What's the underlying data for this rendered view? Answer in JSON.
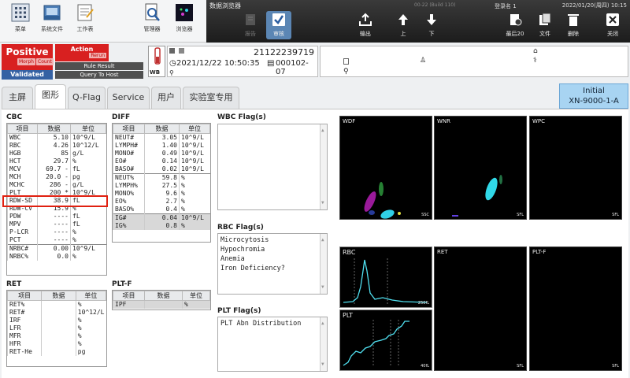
{
  "toolbar_left": [
    {
      "label": "菜单",
      "icon": "menu-grid-icon"
    },
    {
      "label": "系统文件",
      "icon": "system-folder-icon"
    },
    {
      "label": "工作表",
      "icon": "worksheet-icon"
    },
    {
      "label": "管理器",
      "icon": "manager-icon"
    },
    {
      "label": "浏览器",
      "icon": "explorer-icon"
    }
  ],
  "dark_toolbar": {
    "title": "数据浏览器",
    "build": "00-22 (Build 110)",
    "login": "登录名 1",
    "datetime": "2022/01/20(周四) 10:15",
    "buttons": [
      {
        "label": "报告",
        "icon": "report-icon",
        "state": "disabled"
      },
      {
        "label": "审核",
        "icon": "validate-check-icon",
        "state": "selected"
      },
      {
        "label": "输出",
        "icon": "export-icon",
        "state": "normal"
      },
      {
        "label": "上",
        "icon": "arrow-up-icon",
        "state": "normal"
      },
      {
        "label": "下",
        "icon": "arrow-down-icon",
        "state": "normal"
      },
      {
        "label": "最后20",
        "icon": "last20-icon",
        "state": "normal"
      },
      {
        "label": "文件",
        "icon": "file-icon",
        "state": "normal"
      },
      {
        "label": "删除",
        "icon": "trash-icon",
        "state": "normal"
      },
      {
        "label": "关闭",
        "icon": "close-icon",
        "state": "normal"
      }
    ]
  },
  "status": {
    "positive": "Positive",
    "morph": "Morph",
    "count": "Count",
    "validated": "Validated",
    "action": "Action",
    "rerun": "Rerun",
    "rule_result": "Rule Result",
    "query_host": "Query To Host",
    "wb": "WB"
  },
  "sample": {
    "id": "21122239719",
    "datetime": "2021/12/22 10:50:35",
    "seq": "000102-07"
  },
  "tabs": [
    {
      "label": "主屏"
    },
    {
      "label": "图形"
    },
    {
      "label": "Q-Flag"
    },
    {
      "label": "Service"
    },
    {
      "label": "用户"
    },
    {
      "label": "实验室专用"
    }
  ],
  "instrument": {
    "line1": "Initial",
    "line2": "XN-9000-1-A"
  },
  "headers": {
    "item": "项目",
    "data": "数据",
    "unit": "单位"
  },
  "cbc": {
    "title": "CBC",
    "rows": [
      {
        "n": "WBC",
        "v": "5.10",
        "f": "",
        "u": "10^9/L"
      },
      {
        "n": "RBC",
        "v": "4.26",
        "f": "",
        "u": "10^12/L"
      },
      {
        "n": "HGB",
        "v": "85",
        "f": "",
        "u": "g/L"
      },
      {
        "n": "HCT",
        "v": "29.7",
        "f": "",
        "u": "%"
      },
      {
        "n": "MCV",
        "v": "69.7",
        "f": "-",
        "u": "fL"
      },
      {
        "n": "MCH",
        "v": "20.0",
        "f": "-",
        "u": "pg"
      },
      {
        "n": "MCHC",
        "v": "286",
        "f": "-",
        "u": "g/L"
      },
      {
        "n": "PLT",
        "v": "200",
        "f": "*",
        "u": "10^9/L"
      },
      {
        "n": "RDW-SD",
        "v": "38.9",
        "f": "",
        "u": "fL"
      },
      {
        "n": "RDW-CV",
        "v": "15.9",
        "f": "",
        "u": "%"
      },
      {
        "n": "PDW",
        "v": "----",
        "f": "",
        "u": "fL"
      },
      {
        "n": "MPV",
        "v": "----",
        "f": "",
        "u": "fL"
      },
      {
        "n": "P-LCR",
        "v": "----",
        "f": "",
        "u": "%"
      },
      {
        "n": "PCT",
        "v": "----",
        "f": "",
        "u": "%"
      },
      {
        "n": "NRBC#",
        "v": "0.00",
        "f": "",
        "u": "10^9/L"
      },
      {
        "n": "NRBC%",
        "v": "0.0",
        "f": "",
        "u": "%"
      }
    ]
  },
  "diff": {
    "title": "DIFF",
    "rows": [
      {
        "n": "NEUT#",
        "v": "3.05",
        "u": "10^9/L"
      },
      {
        "n": "LYMPH#",
        "v": "1.40",
        "u": "10^9/L"
      },
      {
        "n": "MONO#",
        "v": "0.49",
        "u": "10^9/L"
      },
      {
        "n": "EO#",
        "v": "0.14",
        "u": "10^9/L"
      },
      {
        "n": "BASO#",
        "v": "0.02",
        "u": "10^9/L"
      },
      {
        "n": "NEUT%",
        "v": "59.8",
        "u": "%"
      },
      {
        "n": "LYMPH%",
        "v": "27.5",
        "u": "%"
      },
      {
        "n": "MONO%",
        "v": "9.6",
        "u": "%"
      },
      {
        "n": "EO%",
        "v": "2.7",
        "u": "%"
      },
      {
        "n": "BASO%",
        "v": "0.4",
        "u": "%"
      },
      {
        "n": "IG#",
        "v": "0.04",
        "u": "10^9/L"
      },
      {
        "n": "IG%",
        "v": "0.8",
        "u": "%"
      }
    ]
  },
  "ret": {
    "title": "RET",
    "rows": [
      {
        "n": "RET%",
        "u": "%"
      },
      {
        "n": "RET#",
        "u": "10^12/L"
      },
      {
        "n": "IRF",
        "u": "%"
      },
      {
        "n": "LFR",
        "u": "%"
      },
      {
        "n": "MFR",
        "u": "%"
      },
      {
        "n": "HFR",
        "u": "%"
      },
      {
        "n": "RET-He",
        "u": "pg"
      }
    ]
  },
  "pltf": {
    "title": "PLT-F",
    "rows": [
      {
        "n": "IPF",
        "u": "%"
      }
    ]
  },
  "flags": {
    "wbc_title": "WBC Flag(s)",
    "rbc_title": "RBC Flag(s)",
    "rbc": [
      "Microcytosis",
      "Hypochromia",
      "Anemia",
      "Iron Deficiency?"
    ],
    "plt_title": "PLT Flag(s)",
    "plt": [
      "PLT Abn Distribution"
    ]
  },
  "plots": {
    "wdf": "WDF",
    "wnr": "WNR",
    "wpc": "WPC",
    "rbc": "RBC",
    "ret": "RET",
    "pltf": "PLT-F",
    "plt": "PLT",
    "ssc": "SSC",
    "sfl": "SFL",
    "fl_250": "250fL",
    "fl_40": "40fL"
  }
}
